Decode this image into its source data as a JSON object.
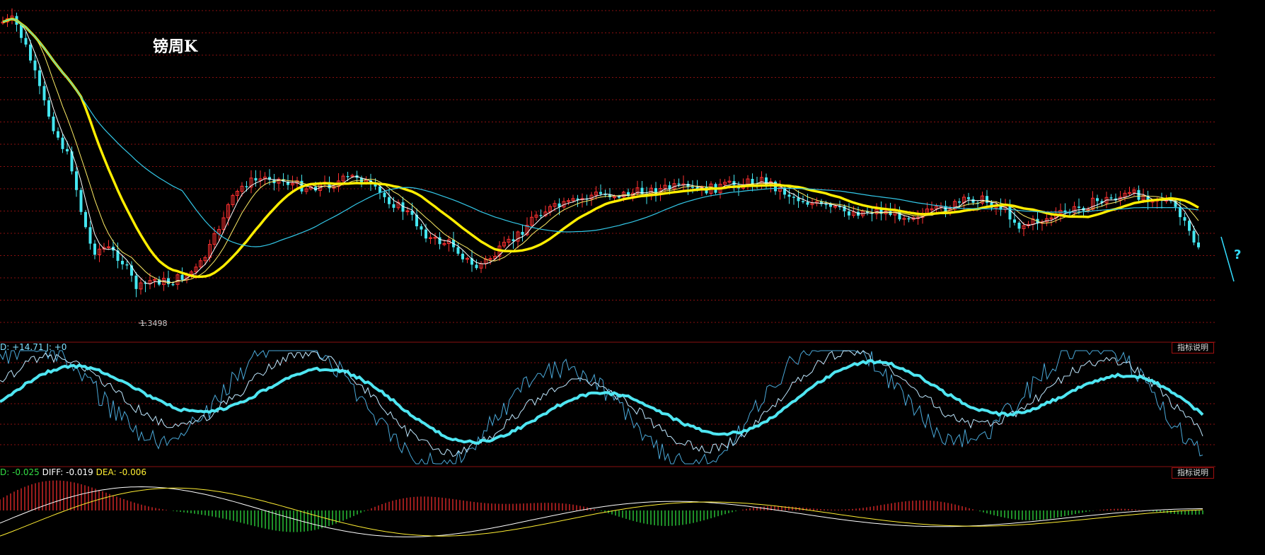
{
  "title": "镑周K",
  "kdj_label": "D: +14.71  J: +0",
  "macd_label": {
    "macd": "D: -0.025",
    "diff": "DIFF: -0.019",
    "dea": "DEA: -0.006"
  },
  "explain_label": "指标说明",
  "question_mark": "?",
  "colors": {
    "background": "#000000",
    "up_candle": "#ff3030",
    "down_candle": "#44e6f0",
    "ma_thick": "#ffee00",
    "ma_long": "#33c8e8",
    "kdj_main": "#4fe6f2",
    "grid": "#8a1010"
  },
  "chart_data": [
    {
      "type": "candlestick",
      "title": "镑周K",
      "low_annotation": "1.3498",
      "series": [
        {
          "name": "K线",
          "shape": "weekly candlesticks, sharp decline then long sideways range, falling at the end"
        },
        {
          "name": "MA-thick",
          "color": "#ffee00"
        },
        {
          "name": "MA-long",
          "color": "#33c8e8"
        }
      ]
    },
    {
      "type": "line",
      "indicator": "KDJ",
      "values_shown": {
        "D": "+14.71",
        "J": "+0"
      }
    },
    {
      "type": "bar",
      "indicator": "MACD",
      "values_shown": {
        "MACD": "-0.025",
        "DIFF": "-0.019",
        "DEA": "-0.006"
      }
    }
  ]
}
